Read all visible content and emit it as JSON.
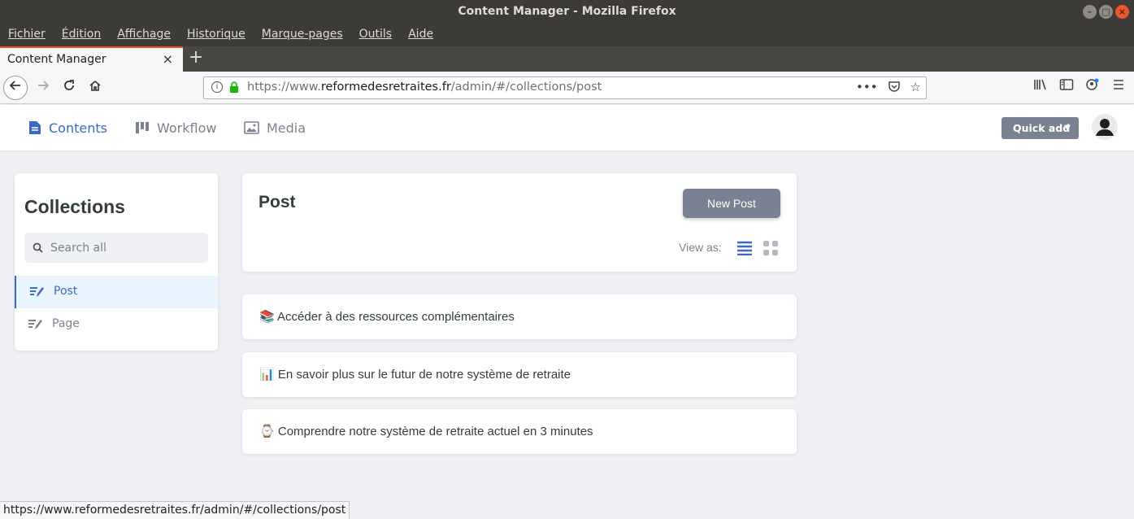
{
  "window": {
    "title": "Content Manager - Mozilla Firefox"
  },
  "menu": {
    "items": [
      {
        "label": "Fichier"
      },
      {
        "label": "Édition"
      },
      {
        "label": "Affichage"
      },
      {
        "label": "Historique"
      },
      {
        "label": "Marque-pages"
      },
      {
        "label": "Outils"
      },
      {
        "label": "Aide"
      }
    ]
  },
  "tab": {
    "title": "Content Manager",
    "close": "×",
    "new": "+"
  },
  "address": {
    "prefix": "https://www.",
    "domain": "reformedesretraites.fr",
    "path": "/admin/#/collections/post"
  },
  "appnav": {
    "contents": "Contents",
    "workflow": "Workflow",
    "media": "Media",
    "quick_add": "Quick add"
  },
  "sidebar": {
    "title": "Collections",
    "search_placeholder": "Search all",
    "items": [
      {
        "label": "Post",
        "active": true
      },
      {
        "label": "Page",
        "active": false
      }
    ]
  },
  "main": {
    "title": "Post",
    "new_button": "New Post",
    "view_as": "View as:"
  },
  "entries": [
    {
      "icon": "📚",
      "title": "Accéder à des ressources complémentaires"
    },
    {
      "icon": "📊",
      "title": "En savoir plus sur le futur de notre système de retraite"
    },
    {
      "icon": "⌚",
      "title": "Comprendre notre système de retraite actuel en 3 minutes"
    }
  ],
  "status": {
    "url": "https://www.reformedesretraites.fr/admin/#/collections/post"
  },
  "colors": {
    "accent": "#3a69c7",
    "button": "#798291",
    "firefox_tab_accent": "#e95420"
  }
}
